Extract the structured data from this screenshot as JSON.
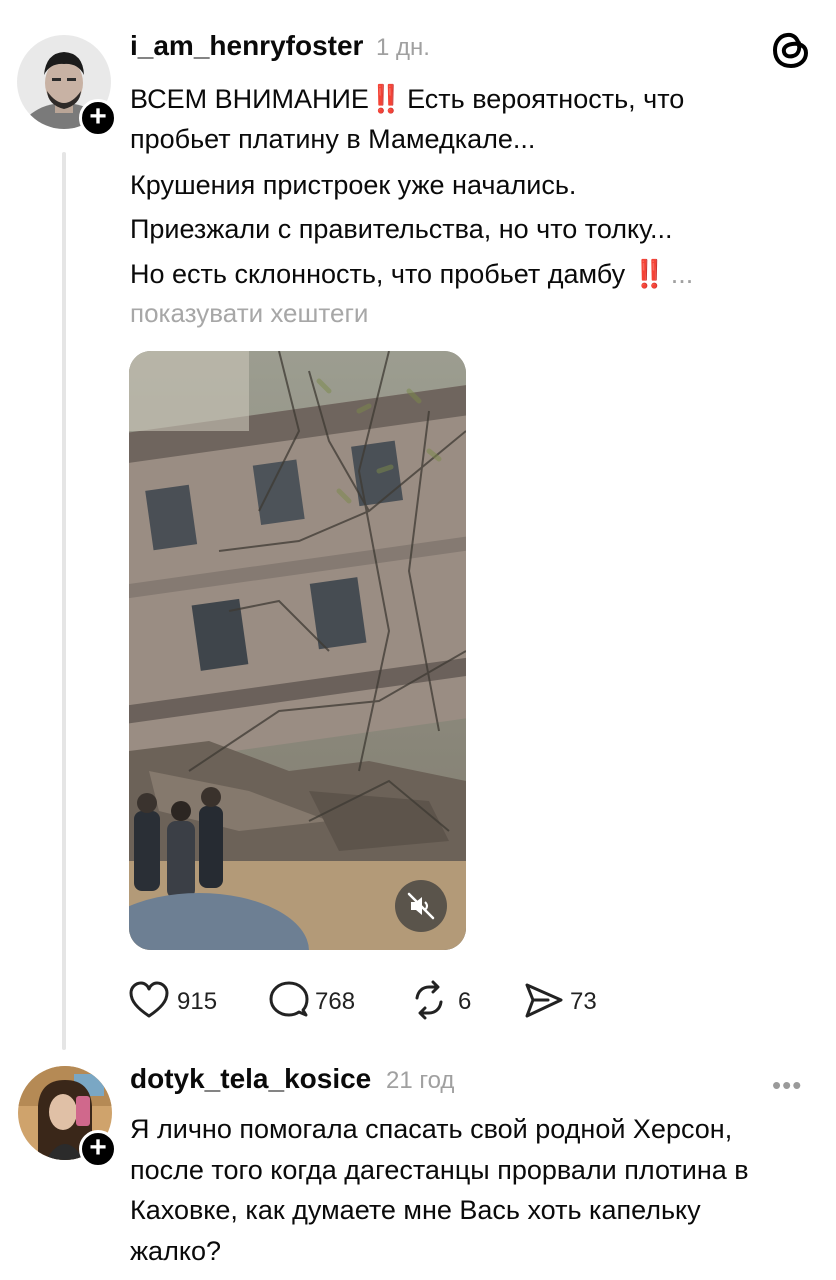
{
  "post": {
    "username": "i_am_henryfoster",
    "time": "1 дн.",
    "lines": [
      {
        "text": "ВСЕМ ВНИМАНИЕ",
        "mark": "‼️",
        "rest": " Есть вероятность, что"
      },
      {
        "text": "пробьет платину в Мамедкале..."
      },
      {
        "text": "Крушения пристроек уже начались."
      },
      {
        "text": "Приезжали с правительства, но что толку..."
      },
      {
        "text": "Но есть склонность, что пробьет дамбу ",
        "mark": "‼️",
        "rest": " ..."
      }
    ],
    "hashtags_link": "показувати хештеги",
    "stats": {
      "likes": "915",
      "comments": "768",
      "reposts": "6",
      "shares": "73"
    },
    "icons": {
      "like": "heart-icon",
      "comment": "comment-bubble-icon",
      "repost": "repost-icon",
      "share": "send-icon",
      "mute": "muted-speaker-icon",
      "app": "threads-logo-icon"
    }
  },
  "reply": {
    "username": "dotyk_tela_kosice",
    "time": "21 год",
    "lines": [
      "Я лично помогала спасать свой родной Херсон,",
      "после того когда дагестанцы прорвали плотина в",
      "Каховке, как думаете мне Вась хоть капельку",
      "жалко?"
    ],
    "more": "•••"
  },
  "colors": {
    "text": "#0a0a0a",
    "muted": "#a0a0a0",
    "mark": "#e0261b",
    "thread_line": "#e5e5e5"
  }
}
